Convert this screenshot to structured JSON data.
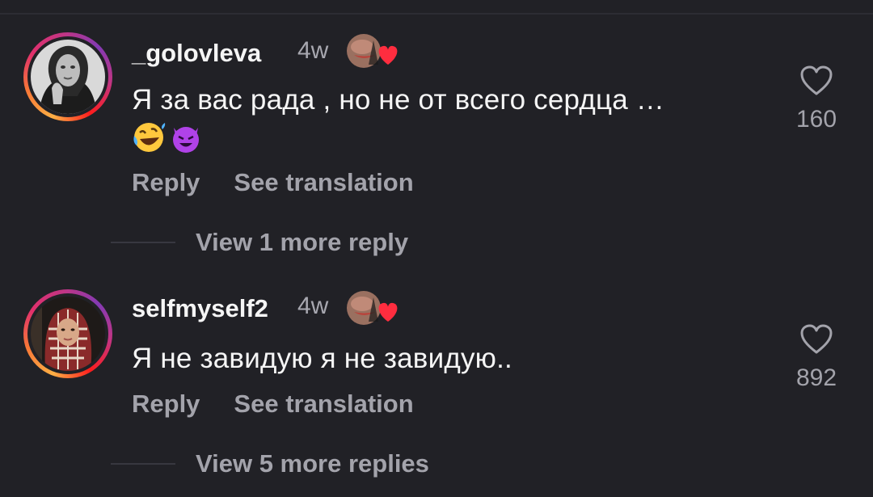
{
  "comments": [
    {
      "username": "_golovleva",
      "time": "4w",
      "text": "Я за вас рада , но не от всего сердца …",
      "emojis": [
        "rolling-laughing-emoji",
        "smiling-devil-emoji"
      ],
      "reply_label": "Reply",
      "translate_label": "See translation",
      "like_count": "160",
      "view_replies": "View 1 more reply"
    },
    {
      "username": "selfmyself2",
      "time": "4w",
      "text": "Я не завидую я не завидую..",
      "reply_label": "Reply",
      "translate_label": "See translation",
      "like_count": "892",
      "view_replies": "View 5 more replies"
    }
  ],
  "colors": {
    "background": "#212126",
    "secondary_text": "#a3a3ab",
    "heart_badge": "#ff2d3f"
  }
}
